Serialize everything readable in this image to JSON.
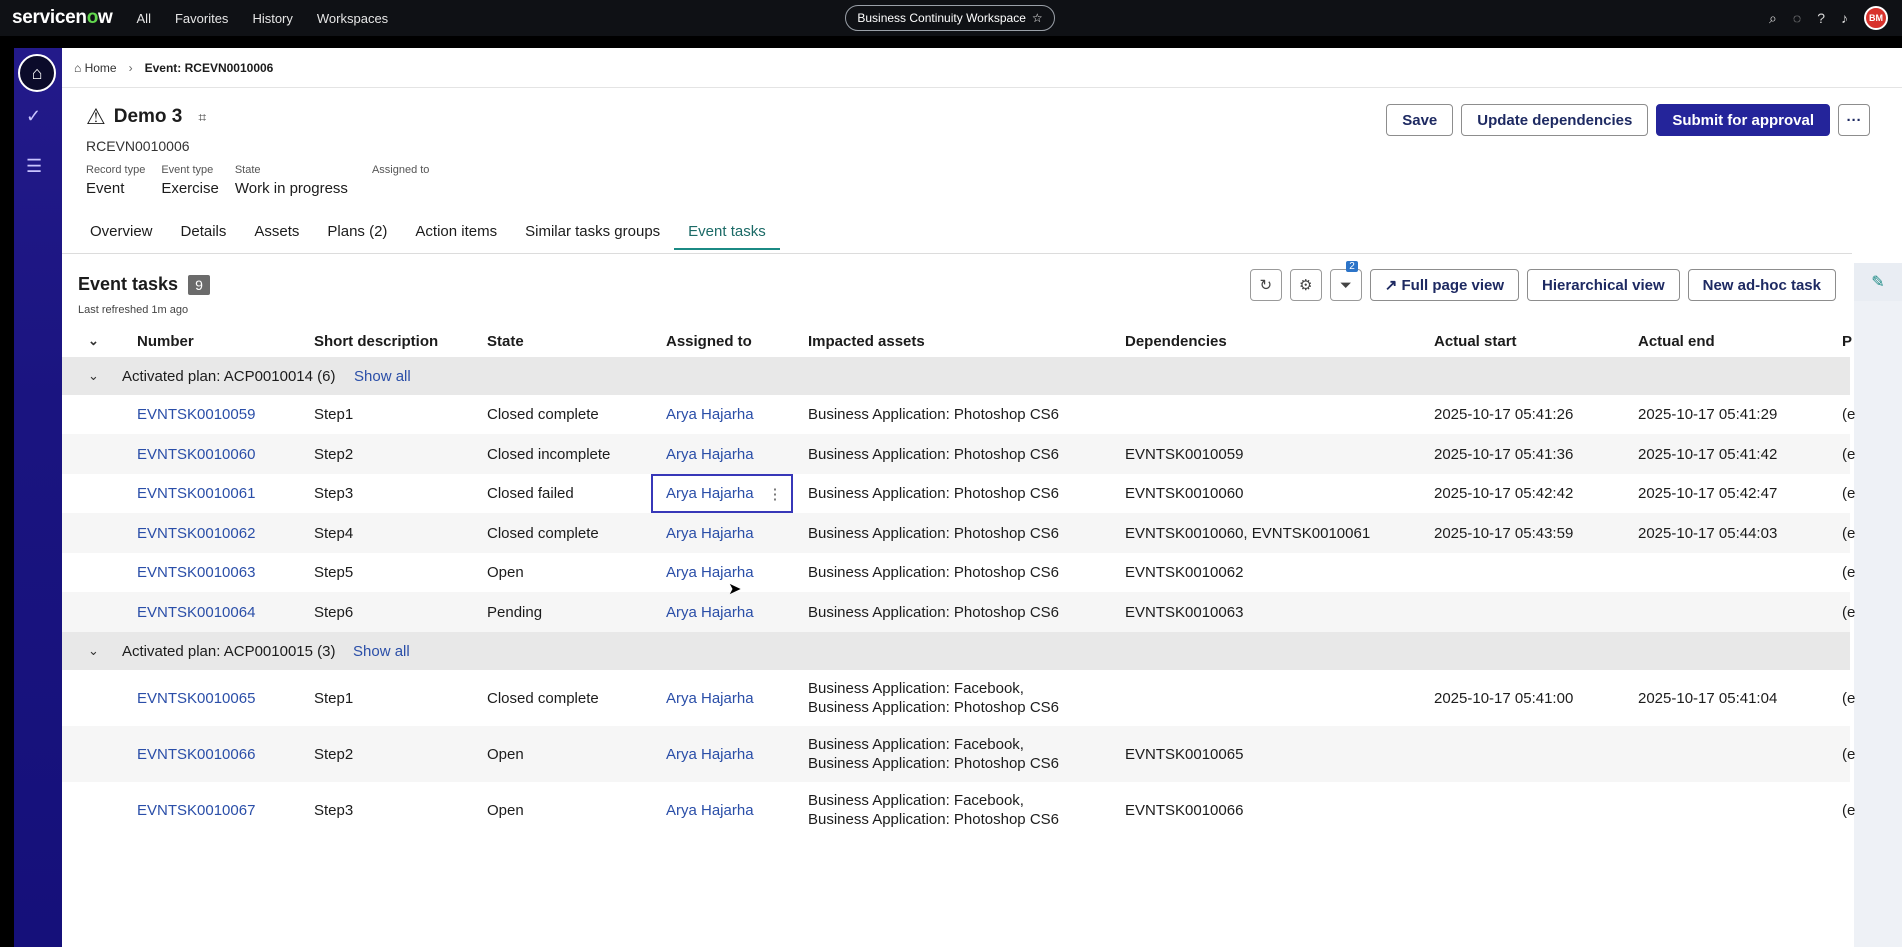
{
  "topnav": {
    "logo_text": "servicenow",
    "links": [
      "All",
      "Favorites",
      "History",
      "Workspaces"
    ],
    "workspace": "Business Continuity Workspace",
    "avatar_initials": "BM"
  },
  "breadcrumb": {
    "home": "Home",
    "current": "Event: RCEVN0010006"
  },
  "record": {
    "title": "Demo 3",
    "number": "RCEVN0010006",
    "fields": [
      {
        "label": "Record type",
        "value": "Event"
      },
      {
        "label": "Event type",
        "value": "Exercise"
      },
      {
        "label": "State",
        "value": "Work in progress"
      },
      {
        "label": "Assigned to",
        "value": ""
      }
    ]
  },
  "actions": {
    "save": "Save",
    "update_deps": "Update dependencies",
    "submit": "Submit for approval",
    "more": "···"
  },
  "tabs": [
    "Overview",
    "Details",
    "Assets",
    "Plans (2)",
    "Action items",
    "Similar tasks groups",
    "Event tasks"
  ],
  "panel": {
    "title": "Event tasks",
    "count": "9",
    "refreshed": "Last refreshed 1m ago",
    "filter_count": "2",
    "full_page": "Full page view",
    "hierarchical": "Hierarchical view",
    "new_task": "New ad-hoc task"
  },
  "table": {
    "headers": [
      "Number",
      "Short description",
      "State",
      "Assigned to",
      "Impacted assets",
      "Dependencies",
      "Actual start",
      "Actual end",
      "P"
    ],
    "groups": [
      {
        "label": "Activated plan: ACP0010014 (6)",
        "show_all": "Show all"
      },
      {
        "label": "Activated plan: ACP0010015 (3)",
        "show_all": "Show all"
      }
    ],
    "rows": [
      {
        "number": "EVNTSK0010059",
        "desc": "Step1",
        "state": "Closed complete",
        "assigned": "Arya Hajarha",
        "assets1": "Business Application: Photoshop CS6",
        "assets2": "",
        "deps": "",
        "start": "2025-10-17 05:41:26",
        "end": "2025-10-17 05:41:29",
        "p": "(e"
      },
      {
        "number": "EVNTSK0010060",
        "desc": "Step2",
        "state": "Closed incomplete",
        "assigned": "Arya Hajarha",
        "assets1": "Business Application: Photoshop CS6",
        "assets2": "",
        "deps": "EVNTSK0010059",
        "start": "2025-10-17 05:41:36",
        "end": "2025-10-17 05:41:42",
        "p": "(e"
      },
      {
        "number": "EVNTSK0010061",
        "desc": "Step3",
        "state": "Closed failed",
        "assigned": "Arya Hajarha",
        "assets1": "Business Application: Photoshop CS6",
        "assets2": "",
        "deps": "EVNTSK0010060",
        "start": "2025-10-17 05:42:42",
        "end": "2025-10-17 05:42:47",
        "p": "(e"
      },
      {
        "number": "EVNTSK0010062",
        "desc": "Step4",
        "state": "Closed complete",
        "assigned": "Arya Hajarha",
        "assets1": "Business Application: Photoshop CS6",
        "assets2": "",
        "deps": "EVNTSK0010060, EVNTSK0010061",
        "start": "2025-10-17 05:43:59",
        "end": "2025-10-17 05:44:03",
        "p": "(e"
      },
      {
        "number": "EVNTSK0010063",
        "desc": "Step5",
        "state": "Open",
        "assigned": "Arya Hajarha",
        "assets1": "Business Application: Photoshop CS6",
        "assets2": "",
        "deps": "EVNTSK0010062",
        "start": "",
        "end": "",
        "p": "(e"
      },
      {
        "number": "EVNTSK0010064",
        "desc": "Step6",
        "state": "Pending",
        "assigned": "Arya Hajarha",
        "assets1": "Business Application: Photoshop CS6",
        "assets2": "",
        "deps": "EVNTSK0010063",
        "start": "",
        "end": "",
        "p": "(e"
      },
      {
        "number": "EVNTSK0010065",
        "desc": "Step1",
        "state": "Closed complete",
        "assigned": "Arya Hajarha",
        "assets1": "Business Application: Facebook,",
        "assets2": "Business Application: Photoshop CS6",
        "deps": "",
        "start": "2025-10-17 05:41:00",
        "end": "2025-10-17 05:41:04",
        "p": "(e"
      },
      {
        "number": "EVNTSK0010066",
        "desc": "Step2",
        "state": "Open",
        "assigned": "Arya Hajarha",
        "assets1": "Business Application: Facebook,",
        "assets2": "Business Application: Photoshop CS6",
        "deps": "EVNTSK0010065",
        "start": "",
        "end": "",
        "p": "(e"
      },
      {
        "number": "EVNTSK0010067",
        "desc": "Step3",
        "state": "Open",
        "assigned": "Arya Hajarha",
        "assets1": "Business Application: Facebook,",
        "assets2": "Business Application: Photoshop CS6",
        "deps": "EVNTSK0010066",
        "start": "",
        "end": "",
        "p": "(e"
      }
    ]
  }
}
